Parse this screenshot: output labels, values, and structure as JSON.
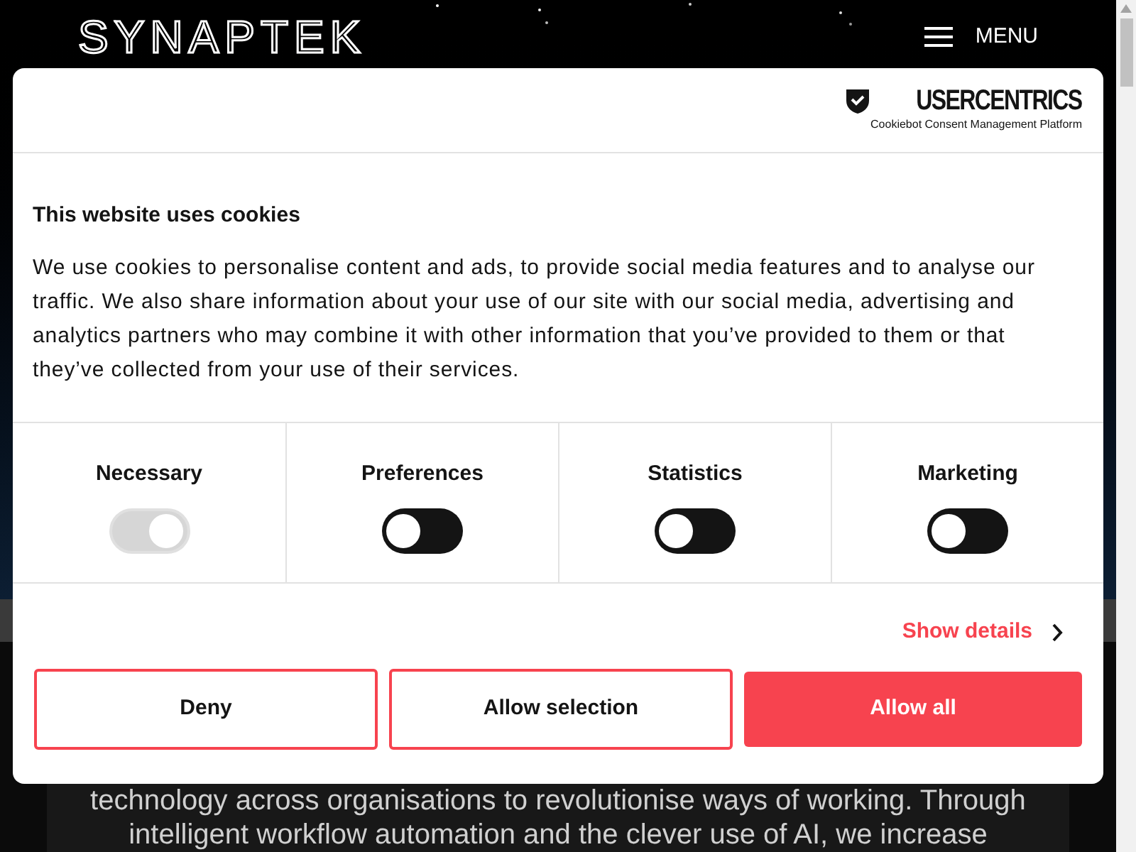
{
  "site": {
    "logo": "SYNAPTEK",
    "menu_label": "MENU",
    "body_lines": [
      "technology across organisations to revolutionise ways of working. Through",
      "intelligent workflow automation and the clever use of AI, we increase"
    ]
  },
  "dialog": {
    "brand": "USERCENTRICS",
    "brand_subtitle": "Cookiebot Consent Management Platform",
    "title": "This website uses cookies",
    "text": "We use cookies to personalise content and ads, to provide social media features and to analyse our traffic. We also share information about your use of our site with our social media, advertising and analytics partners who may combine it with other information that you’ve provided to them or that they’ve collected from your use of their services.",
    "categories": [
      {
        "label": "Necessary",
        "on": true,
        "disabled": true
      },
      {
        "label": "Preferences",
        "on": false,
        "disabled": false
      },
      {
        "label": "Statistics",
        "on": false,
        "disabled": false
      },
      {
        "label": "Marketing",
        "on": false,
        "disabled": false
      }
    ],
    "show_details": "Show details",
    "buttons": [
      {
        "label": "Deny",
        "kind": "outline"
      },
      {
        "label": "Allow selection",
        "kind": "outline"
      },
      {
        "label": "Allow all",
        "kind": "primary"
      }
    ]
  }
}
